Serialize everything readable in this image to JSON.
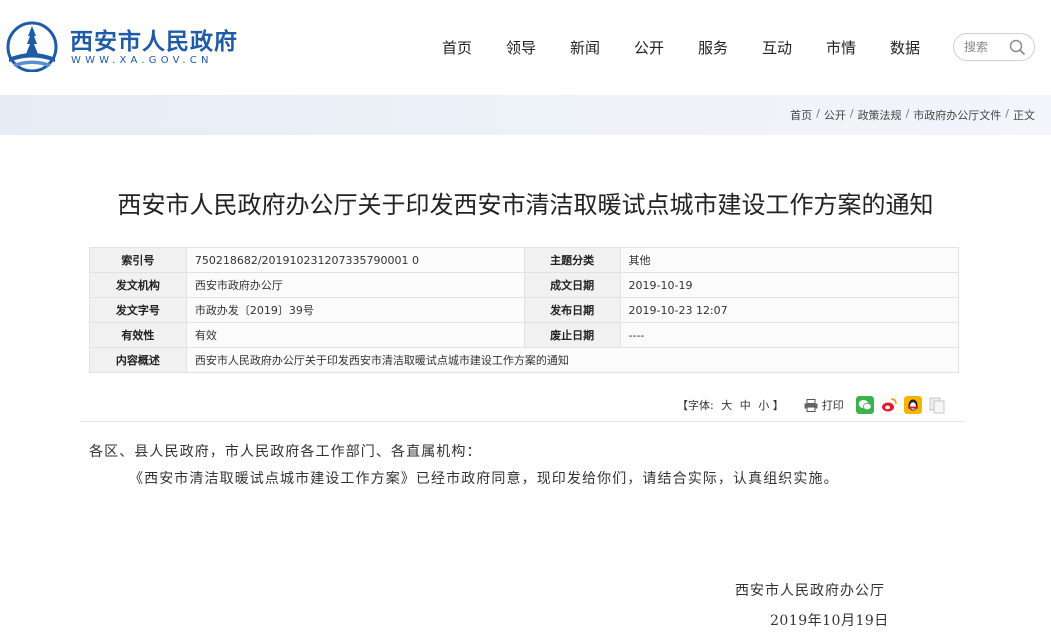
{
  "header": {
    "site_name": "西安市人民政府",
    "site_url": "WWW.XA.GOV.CN",
    "nav": [
      "首页",
      "领导",
      "新闻",
      "公开",
      "服务",
      "互动",
      "市情",
      "数据"
    ],
    "search_placeholder": "搜索"
  },
  "breadcrumb": [
    "首页",
    "公开",
    "政策法规",
    "市政府办公厅文件",
    "正文"
  ],
  "article": {
    "title": "西安市人民政府办公厅关于印发西安市清洁取暖试点城市建设工作方案的通知"
  },
  "meta": {
    "index_label": "索引号",
    "index_value": "750218682/201910231207335790001 0",
    "topic_label": "主题分类",
    "topic_value": "其他",
    "issuer_label": "发文机构",
    "issuer_value": "西安市政府办公厅",
    "created_label": "成文日期",
    "created_value": "2019-10-19",
    "docno_label": "发文字号",
    "docno_value": "市政办发〔2019〕39号",
    "published_label": "发布日期",
    "published_value": "2019-10-23 12:07",
    "valid_label": "有效性",
    "valid_value": "有效",
    "abolish_label": "废止日期",
    "abolish_value": "----",
    "summary_label": "内容概述",
    "summary_value": "西安市人民政府办公厅关于印发西安市清洁取暖试点城市建设工作方案的通知"
  },
  "tools": {
    "font_prefix": "【字体:",
    "font_large": "大",
    "font_medium": "中",
    "font_small": "小",
    "font_suffix": "】",
    "print_label": "打印"
  },
  "content": {
    "salutation": "各区、县人民政府，市人民政府各工作部门、各直属机构：",
    "paragraph": "《西安市清洁取暖试点城市建设工作方案》已经市政府同意，现印发给你们，请结合实际，认真组织实施。",
    "signature": "西安市人民政府办公厅",
    "date": "2019年10月19日"
  },
  "colors": {
    "brand": "#1f5ba8",
    "wechat": "#3bb24a",
    "weibo": "#e6162d",
    "qzone": "#f4b400"
  }
}
